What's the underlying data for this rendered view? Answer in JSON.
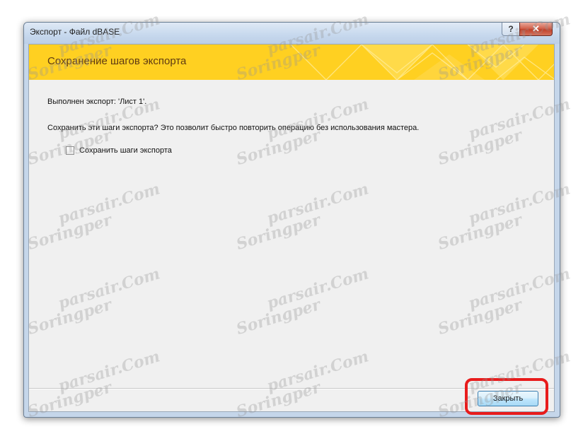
{
  "window": {
    "title": "Экспорт - Файл dBASE",
    "help_label": "?",
    "close_label": "✕"
  },
  "header": {
    "title": "Сохранение шагов экспорта"
  },
  "body": {
    "status_text": "Выполнен экспорт: 'Лист 1'.",
    "question_text": "Сохранить эти шаги экспорта? Это позволит быстро повторить операцию без использования мастера.",
    "checkbox": {
      "label": "Сохранить шаги экспорта",
      "checked": false
    }
  },
  "footer": {
    "close_button_label": "Закрыть"
  },
  "watermark": {
    "line_top": "parsair.Com",
    "line_bottom": "Soringper"
  },
  "colors": {
    "banner": "#ffd021",
    "banner_title": "#5e3a12",
    "highlight": "#e81c1c"
  }
}
